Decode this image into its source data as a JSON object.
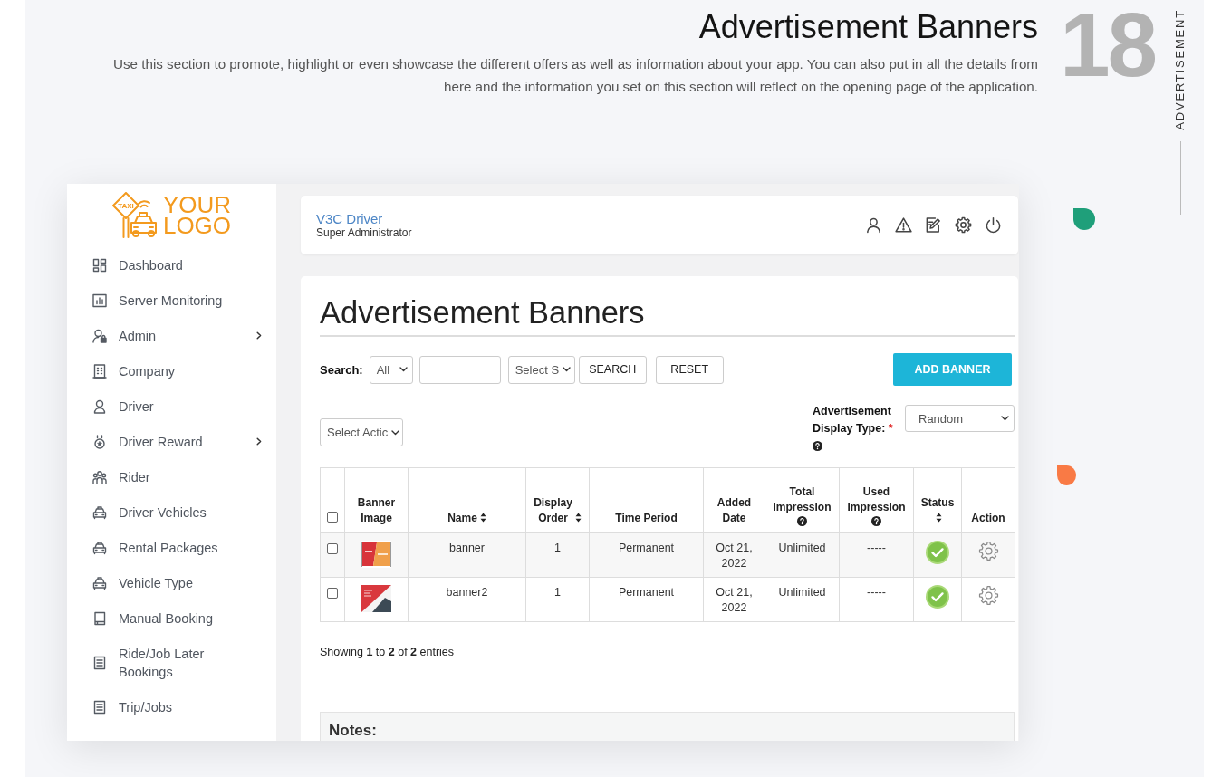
{
  "header": {
    "title": "Advertisement Banners",
    "description": "Use this section to promote, highlight or even showcase the different offers as well as information about your app. You can also put in all the details from here and the information you set on this section will reflect on the opening page of the application.",
    "number": "18",
    "section_label": "ADVERTISEMENT"
  },
  "sidebar": {
    "logo": {
      "badge": "TAXI",
      "text": "YOUR LOGO"
    },
    "items": [
      {
        "label": "Dashboard",
        "has_submenu": false,
        "selected": false
      },
      {
        "label": "Server Monitoring",
        "has_submenu": false,
        "selected": false
      },
      {
        "label": "Admin",
        "has_submenu": true,
        "selected": false
      },
      {
        "label": "Company",
        "has_submenu": false,
        "selected": false
      },
      {
        "label": "Driver",
        "has_submenu": false,
        "selected": false
      },
      {
        "label": "Driver Reward",
        "has_submenu": true,
        "selected": false
      },
      {
        "label": "Rider",
        "has_submenu": false,
        "selected": false
      },
      {
        "label": "Driver Vehicles",
        "has_submenu": false,
        "selected": false
      },
      {
        "label": "Rental Packages",
        "has_submenu": false,
        "selected": false
      },
      {
        "label": "Vehicle Type",
        "has_submenu": false,
        "selected": false
      },
      {
        "label": "Manual Booking",
        "has_submenu": false,
        "selected": false
      },
      {
        "label": "Ride/Job Later Bookings",
        "has_submenu": false,
        "selected": false
      },
      {
        "label": "Trip/Jobs",
        "has_submenu": false,
        "selected": false
      }
    ]
  },
  "topbar": {
    "app_name": "V3C Driver",
    "role": "Super Administrator"
  },
  "page": {
    "title": "Advertisement Banners",
    "search": {
      "label": "Search:",
      "scope_select": "All",
      "status_select": "Select S",
      "buttons": [
        {
          "label": "SEARCH"
        },
        {
          "label": "RESET"
        }
      ]
    },
    "add_button": "ADD BANNER",
    "bulk_action_select": "Select Actic",
    "display_type": {
      "label": "Advertisement Display Type:",
      "required": true,
      "required_mark": "*",
      "value": "Random"
    },
    "table": {
      "select_all_checked": false,
      "columns": [
        {
          "label": "Banner Image",
          "sortable": false,
          "help": false
        },
        {
          "label": "Name",
          "sortable": true,
          "help": false
        },
        {
          "label": "Display Order",
          "sortable": true,
          "help": false
        },
        {
          "label": "Time Period",
          "sortable": false,
          "help": false
        },
        {
          "label": "Added Date",
          "sortable": false,
          "help": false
        },
        {
          "label": "Total Impression",
          "sortable": false,
          "help": true
        },
        {
          "label": "Used Impression",
          "sortable": false,
          "help": true
        },
        {
          "label": "Status",
          "sortable": true,
          "help": false
        },
        {
          "label": "Action",
          "sortable": false,
          "help": false
        }
      ],
      "rows": [
        {
          "checked": false,
          "name": "banner",
          "display_order": "1",
          "time_period": "Permanent",
          "added_date": "Oct 21, 2022",
          "total_impression": "Unlimited",
          "used_impression": "-----",
          "active": true
        },
        {
          "checked": false,
          "name": "banner2",
          "display_order": "1",
          "time_period": "Permanent",
          "added_date": "Oct 21, 2022",
          "total_impression": "Unlimited",
          "used_impression": "-----",
          "active": true
        }
      ]
    },
    "summary": "Showing **1** to **2** of **2** entries",
    "notes_title": "Notes:"
  }
}
